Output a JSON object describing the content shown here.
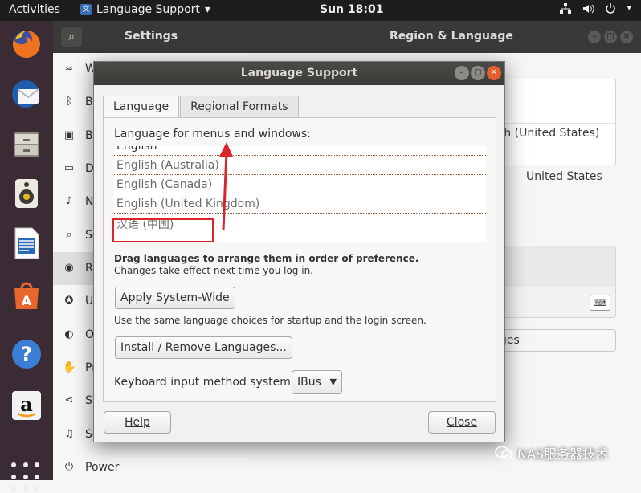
{
  "topbar": {
    "activities": "Activities",
    "app_name": "Language Support",
    "app_menu_arrow": "▾",
    "clock": "Sun 18:01",
    "tray_icons": [
      "network-icon",
      "volume-icon",
      "power-icon"
    ]
  },
  "dock": {
    "items": [
      "firefox-icon",
      "thunderbird-icon",
      "files-icon",
      "rhythmbox-icon",
      "writer-icon",
      "software-icon",
      "help-icon",
      "amazon-icon"
    ]
  },
  "settings": {
    "header_title": "Settings",
    "panel_title": "Region & Language",
    "sidebar": [
      {
        "glyph": "≈",
        "label": "Wi-Fi"
      },
      {
        "glyph": "ᛒ",
        "label": "Bluetooth"
      },
      {
        "glyph": "▣",
        "label": "Background"
      },
      {
        "glyph": "▭",
        "label": "Dock"
      },
      {
        "glyph": "♪",
        "label": "Notifications"
      },
      {
        "glyph": "⌕",
        "label": "Search"
      },
      {
        "glyph": "◉",
        "label": "Region & Language"
      },
      {
        "glyph": "✪",
        "label": "Universal Access"
      },
      {
        "glyph": "◐",
        "label": "Online Accounts"
      },
      {
        "glyph": "✋",
        "label": "Privacy"
      },
      {
        "glyph": "⋖",
        "label": "Sharing"
      },
      {
        "glyph": "♫",
        "label": "Sound"
      },
      {
        "glyph": "⏻",
        "label": "Power"
      }
    ],
    "right_language_value": "sh (United States)",
    "right_formats_value": "United States",
    "right_manage_button": "ges"
  },
  "dialog": {
    "title": "Language Support",
    "tabs": [
      "Language",
      "Regional Formats"
    ],
    "section_label": "Language for menus and windows:",
    "languages": [
      "English",
      "English (Australia)",
      "English (Canada)",
      "English (United Kingdom)",
      "汉语 (中国)"
    ],
    "drag_note": "Drag languages to arrange them in order of preference.",
    "changes_note": "Changes take effect next time you log in.",
    "apply_button": "Apply System-Wide",
    "apply_note": "Use the same language choices for startup and the login screen.",
    "install_button": "Install / Remove Languages...",
    "keyboard_label": "Keyboard input method system:",
    "keyboard_value": "IBus",
    "help_button": "Help",
    "close_button": "Close"
  },
  "watermark": "NAS服务器技术"
}
